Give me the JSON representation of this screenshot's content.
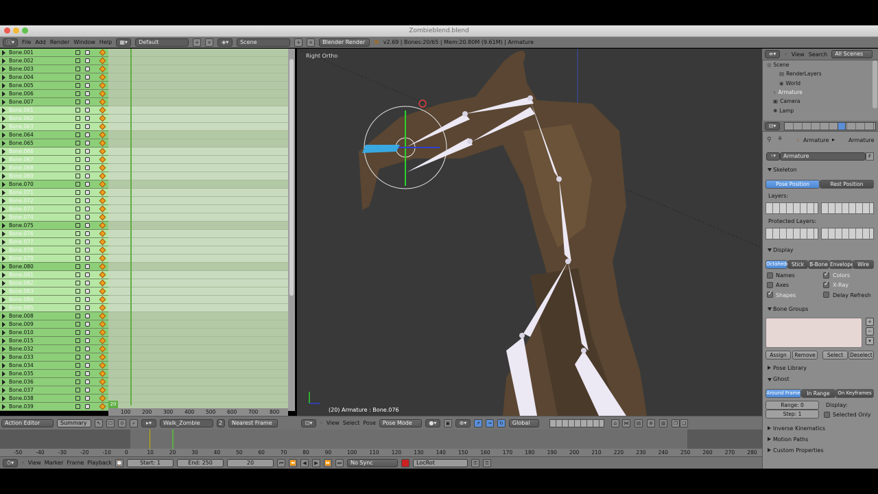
{
  "window": {
    "title": "Zombieblend.blend"
  },
  "info_header": {
    "menus": [
      "File",
      "Add",
      "Render",
      "Window",
      "Help"
    ],
    "screen_layout": "Default",
    "scene": "Scene",
    "render_engine": "Blender Render",
    "stats": "v2.69 | Bones:20/65 | Mem:20.80M (9.61M) | Armature"
  },
  "channels": [
    {
      "name": "Bone.001",
      "selected": false
    },
    {
      "name": "Bone.002",
      "selected": false
    },
    {
      "name": "Bone.003",
      "selected": false
    },
    {
      "name": "Bone.004",
      "selected": false
    },
    {
      "name": "Bone.005",
      "selected": false
    },
    {
      "name": "Bone.006",
      "selected": false
    },
    {
      "name": "Bone.007",
      "selected": false
    },
    {
      "name": "Bone.061",
      "selected": true
    },
    {
      "name": "Bone.062",
      "selected": true
    },
    {
      "name": "Bone.063",
      "selected": true
    },
    {
      "name": "Bone.064",
      "selected": false
    },
    {
      "name": "Bone.065",
      "selected": false
    },
    {
      "name": "Bone.066",
      "selected": true
    },
    {
      "name": "Bone.067",
      "selected": true
    },
    {
      "name": "Bone.068",
      "selected": true
    },
    {
      "name": "Bone.069",
      "selected": true
    },
    {
      "name": "Bone.070",
      "selected": false
    },
    {
      "name": "Bone.071",
      "selected": true
    },
    {
      "name": "Bone.072",
      "selected": true
    },
    {
      "name": "Bone.073",
      "selected": true
    },
    {
      "name": "Bone.074",
      "selected": true
    },
    {
      "name": "Bone.075",
      "selected": false
    },
    {
      "name": "Bone.076",
      "selected": true
    },
    {
      "name": "Bone.077",
      "selected": true
    },
    {
      "name": "Bone.078",
      "selected": true
    },
    {
      "name": "Bone.079",
      "selected": true
    },
    {
      "name": "Bone.080",
      "selected": false
    },
    {
      "name": "Bone.081",
      "selected": true
    },
    {
      "name": "Bone.082",
      "selected": true
    },
    {
      "name": "Bone.083",
      "selected": true
    },
    {
      "name": "Bone.084",
      "selected": true
    },
    {
      "name": "Bone.085",
      "selected": true
    },
    {
      "name": "Bone.008",
      "selected": false
    },
    {
      "name": "Bone.009",
      "selected": false
    },
    {
      "name": "Bone.010",
      "selected": false
    },
    {
      "name": "Bone.015",
      "selected": false
    },
    {
      "name": "Bone.032",
      "selected": false
    },
    {
      "name": "Bone.033",
      "selected": false
    },
    {
      "name": "Bone.034",
      "selected": false
    },
    {
      "name": "Bone.035",
      "selected": false
    },
    {
      "name": "Bone.036",
      "selected": false
    },
    {
      "name": "Bone.037",
      "selected": false
    },
    {
      "name": "Bone.038",
      "selected": false
    },
    {
      "name": "Bone.039",
      "selected": false
    }
  ],
  "dopesheet": {
    "ticks": [
      "100",
      "200",
      "300",
      "400",
      "500",
      "600",
      "700",
      "800"
    ],
    "current_frame_badge": "20",
    "header": {
      "mode": "Action Editor",
      "summary": "Summary",
      "action": "Walk_Zombie",
      "users": "2",
      "snap": "Nearest Frame"
    }
  },
  "viewport": {
    "view_label": "Right Ortho",
    "object_label": "(20) Armature : Bone.076",
    "header": {
      "menus": [
        "View",
        "Select",
        "Pose"
      ],
      "mode": "Pose Mode",
      "orientation": "Global"
    }
  },
  "outliner": {
    "menus": [
      "View",
      "Search"
    ],
    "filter": "All Scenes",
    "items": [
      {
        "name": "Scene",
        "indent": 0
      },
      {
        "name": "RenderLayers",
        "indent": 2
      },
      {
        "name": "World",
        "indent": 2
      },
      {
        "name": "Armature",
        "indent": 1
      },
      {
        "name": "Camera",
        "indent": 1
      },
      {
        "name": "Lamp",
        "indent": 1
      }
    ]
  },
  "properties": {
    "breadcrumb": [
      "Armature",
      "Armature"
    ],
    "datablock": "Armature",
    "datablock_flag": "F",
    "skeleton": {
      "title": "Skeleton",
      "pose_position": "Pose Position",
      "rest_position": "Rest Position",
      "layers": "Layers:",
      "protected_layers": "Protected Layers:"
    },
    "display": {
      "title": "Display",
      "modes": [
        "Octahedral",
        "Stick",
        "B-Bone",
        "Envelope",
        "Wire"
      ],
      "active_mode": "Octahedral",
      "names": "Names",
      "axes": "Axes",
      "shapes": "Shapes",
      "colors": "Colors",
      "xray": "X-Ray",
      "delay_refresh": "Delay Refresh"
    },
    "bone_groups": {
      "title": "Bone Groups",
      "assign": "Assign",
      "remove": "Remove",
      "select": "Select",
      "deselect": "Deselect"
    },
    "pose_library": "Pose Library",
    "ghost": {
      "title": "Ghost",
      "modes": [
        "Around Frame",
        "In Range",
        "On Keyframes"
      ],
      "range": "Range: 0",
      "step": "Step: 1",
      "display": "Display:",
      "selected_only": "Selected Only"
    },
    "collapsed": [
      "Inverse Kinematics",
      "Motion Paths",
      "Custom Properties"
    ]
  },
  "timeline": {
    "ticks": [
      "-50",
      "-40",
      "-30",
      "-20",
      "-10",
      "0",
      "10",
      "20",
      "30",
      "40",
      "50",
      "60",
      "70",
      "80",
      "90",
      "100",
      "110",
      "120",
      "130",
      "140",
      "150",
      "160",
      "170",
      "180",
      "190",
      "200",
      "210",
      "220",
      "230",
      "240",
      "250",
      "260",
      "270",
      "280"
    ],
    "menus": [
      "View",
      "Marker",
      "Frame",
      "Playback"
    ],
    "start": "Start: 1",
    "end": "End: 250",
    "current": "20",
    "sync": "No Sync",
    "keying_set": "LocRot"
  }
}
